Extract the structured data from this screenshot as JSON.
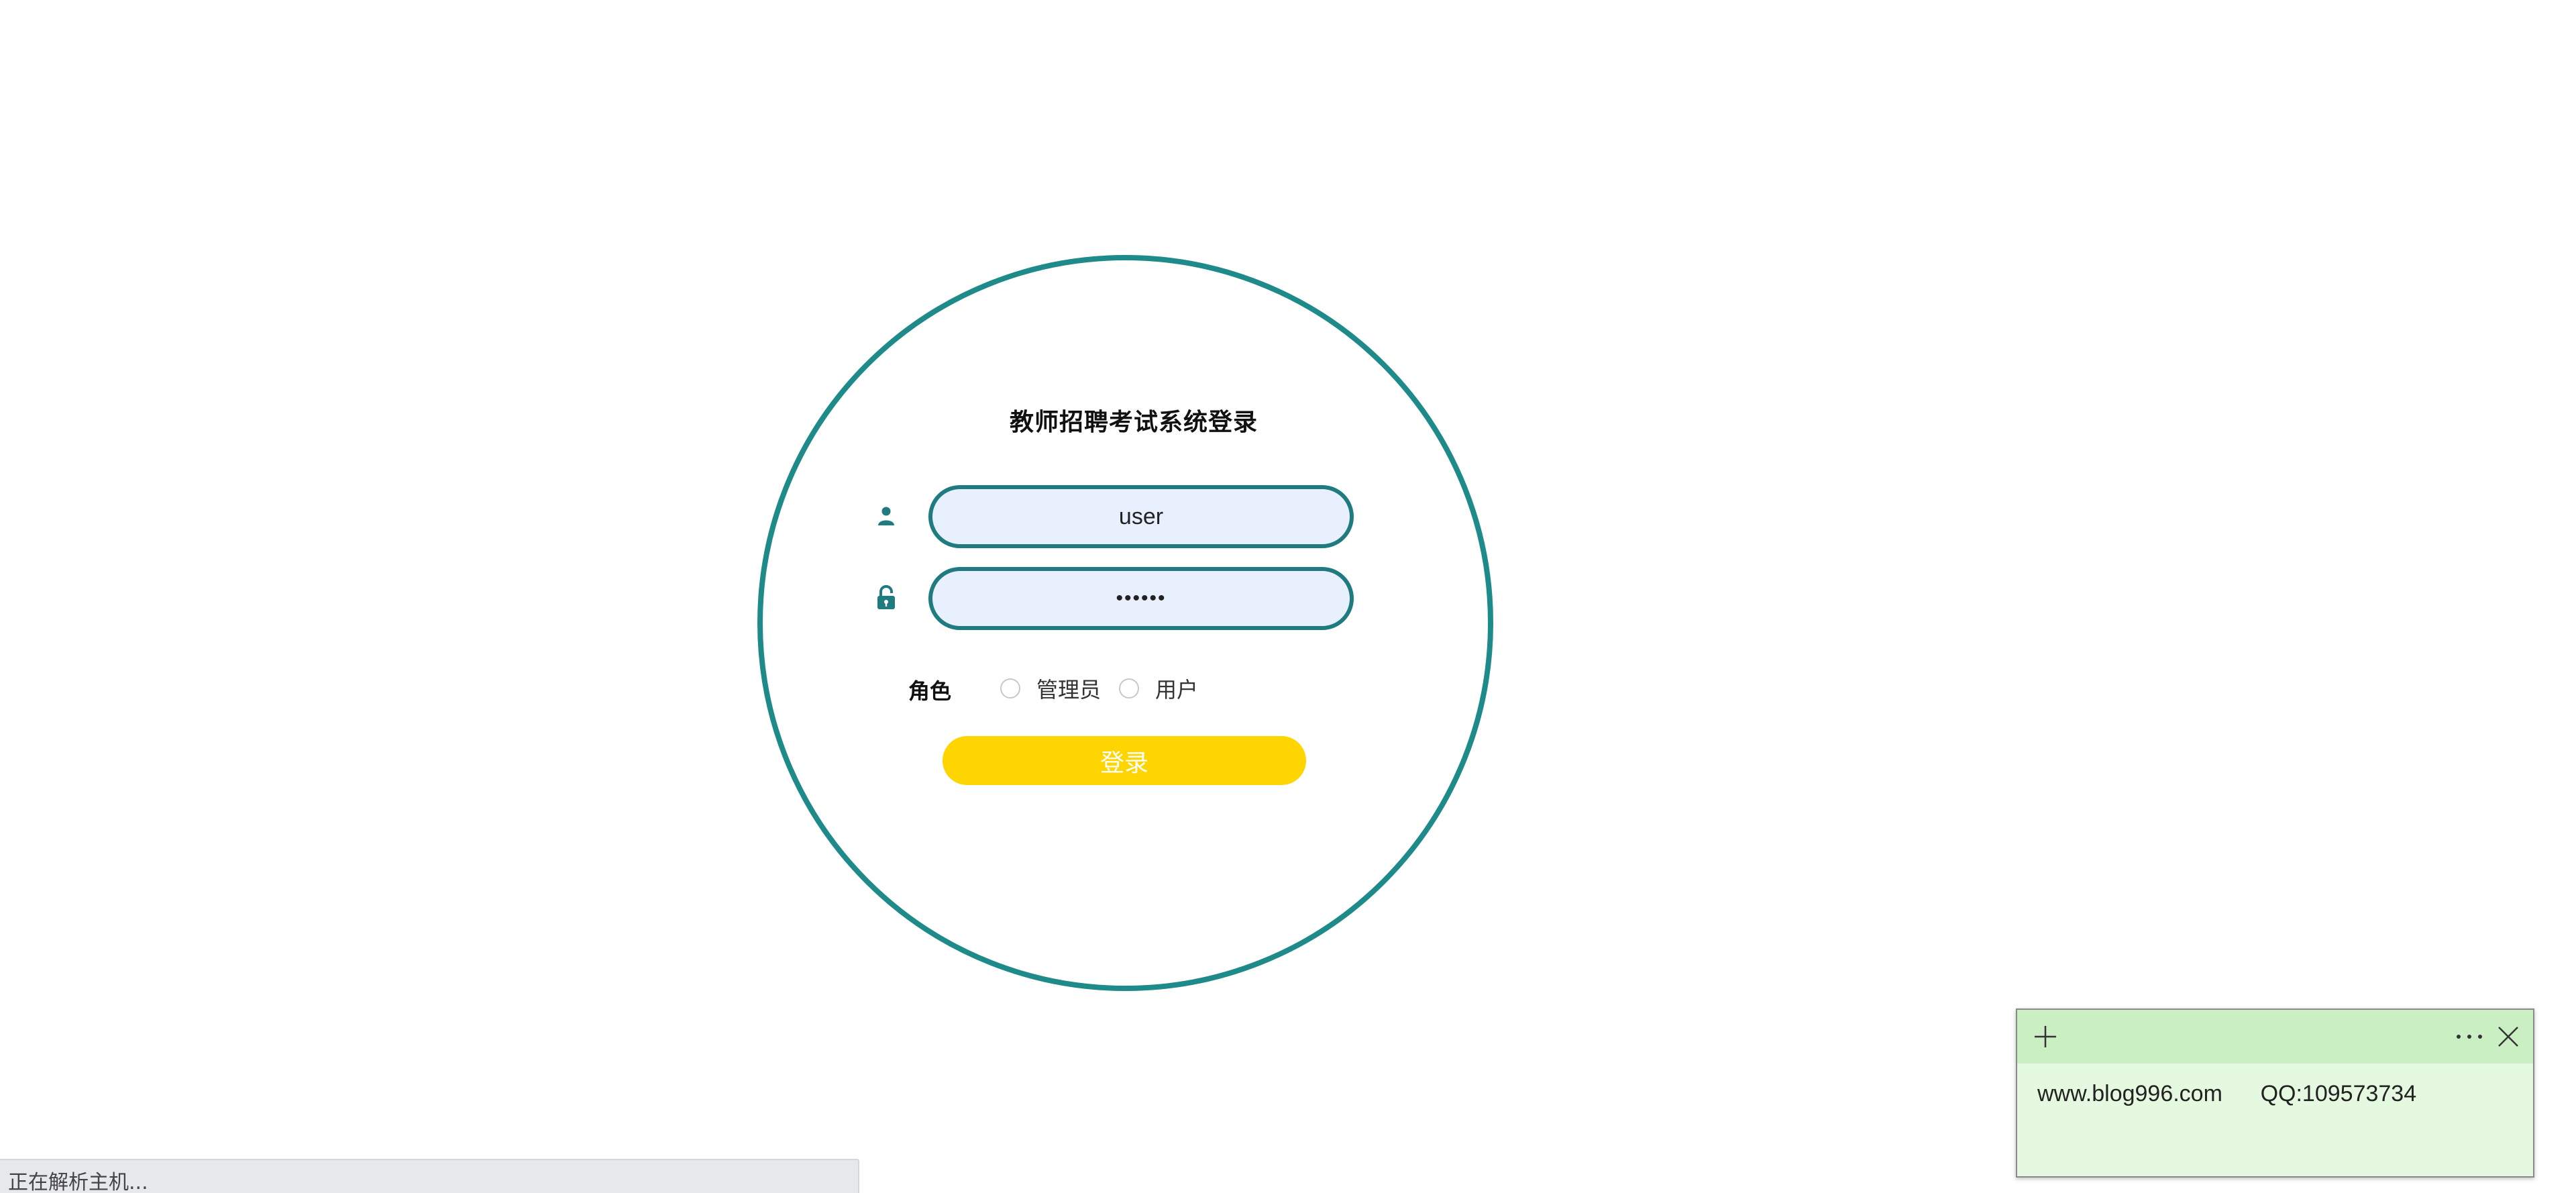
{
  "login": {
    "title": "教师招聘考试系统登录",
    "username": {
      "value": "user",
      "icon": "user-icon"
    },
    "password": {
      "value": "••••••",
      "icon": "lock-icon"
    },
    "role": {
      "label": "角色",
      "options": [
        "管理员",
        "用户"
      ]
    },
    "submit_label": "登录"
  },
  "status_bar": {
    "text": "正在解析主机..."
  },
  "sticky_note": {
    "add_icon": "plus-icon",
    "menu_icon": "more-icon",
    "close_icon": "close-icon",
    "content": "www.blog996.com      QQ:109573734"
  },
  "colors": {
    "accent": "#1f8a8a",
    "input_bg": "#e8f0fe",
    "button": "#ffd500",
    "sticky_header": "#c9efc3",
    "sticky_body": "#e4f9df"
  }
}
